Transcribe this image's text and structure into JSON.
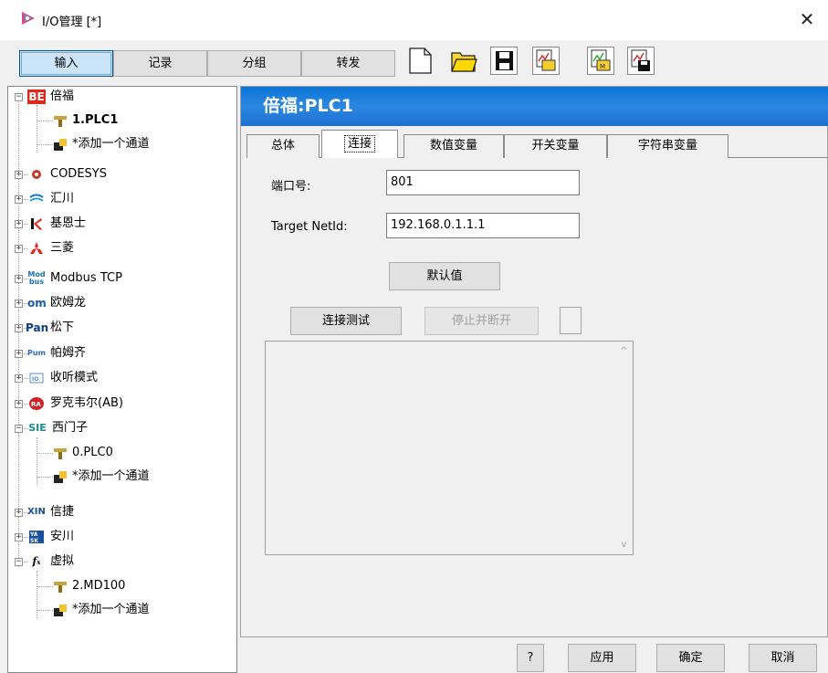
{
  "window": {
    "title": "I/O管理 [*]",
    "close_glyph": "✕"
  },
  "toolbar": {
    "buttons": [
      "输入",
      "记录",
      "分组",
      "转发"
    ],
    "icons": [
      "new-document-icon",
      "open-folder-icon",
      "save-icon",
      "import-icon",
      "export-icon",
      "save-config-icon"
    ]
  },
  "tree": {
    "items": [
      {
        "label": "倍福",
        "icon": "BE"
      },
      {
        "label": "1.PLC1"
      },
      {
        "label": "*添加一个通道"
      },
      {
        "label": "CODESYS"
      },
      {
        "label": "汇川"
      },
      {
        "label": "基恩士"
      },
      {
        "label": "三菱"
      },
      {
        "label": "Modbus TCP",
        "icon": "Mod\nbus"
      },
      {
        "label": "欧姆龙",
        "icon": "om"
      },
      {
        "label": "松下",
        "icon": "Pan"
      },
      {
        "label": "帕姆齐",
        "icon": "Pum"
      },
      {
        "label": "收听模式"
      },
      {
        "label": "罗克韦尔(AB)",
        "icon": "RA"
      },
      {
        "label": "西门子",
        "icon": "SIE"
      },
      {
        "label": "0.PLC0"
      },
      {
        "label": "*添加一个通道"
      },
      {
        "label": "信捷",
        "icon": "XIN"
      },
      {
        "label": "安川"
      },
      {
        "label": "虚拟"
      },
      {
        "label": "2.MD100"
      },
      {
        "label": "*添加一个通道"
      }
    ]
  },
  "panel": {
    "title": "倍福:PLC1",
    "tabs": [
      "总体",
      "连接",
      "数值变量",
      "开关变量",
      "字符串变量"
    ],
    "active_tab": "连接",
    "port_label": "端口号:",
    "port_value": "801",
    "netid_label": "Target NetId:",
    "netid_value": "192.168.0.1.1.1",
    "default_button": "默认值",
    "test_button": "连接测试",
    "stop_button": "停止并断开",
    "scroll_up": "^",
    "scroll_down": "v"
  },
  "footer": {
    "help": "?",
    "apply": "应用",
    "ok": "确定",
    "cancel": "取消"
  },
  "colors": {
    "header_blue": "#1a7ad8",
    "active_tool": "#cce4f7",
    "brand_red": "#e0281e"
  }
}
